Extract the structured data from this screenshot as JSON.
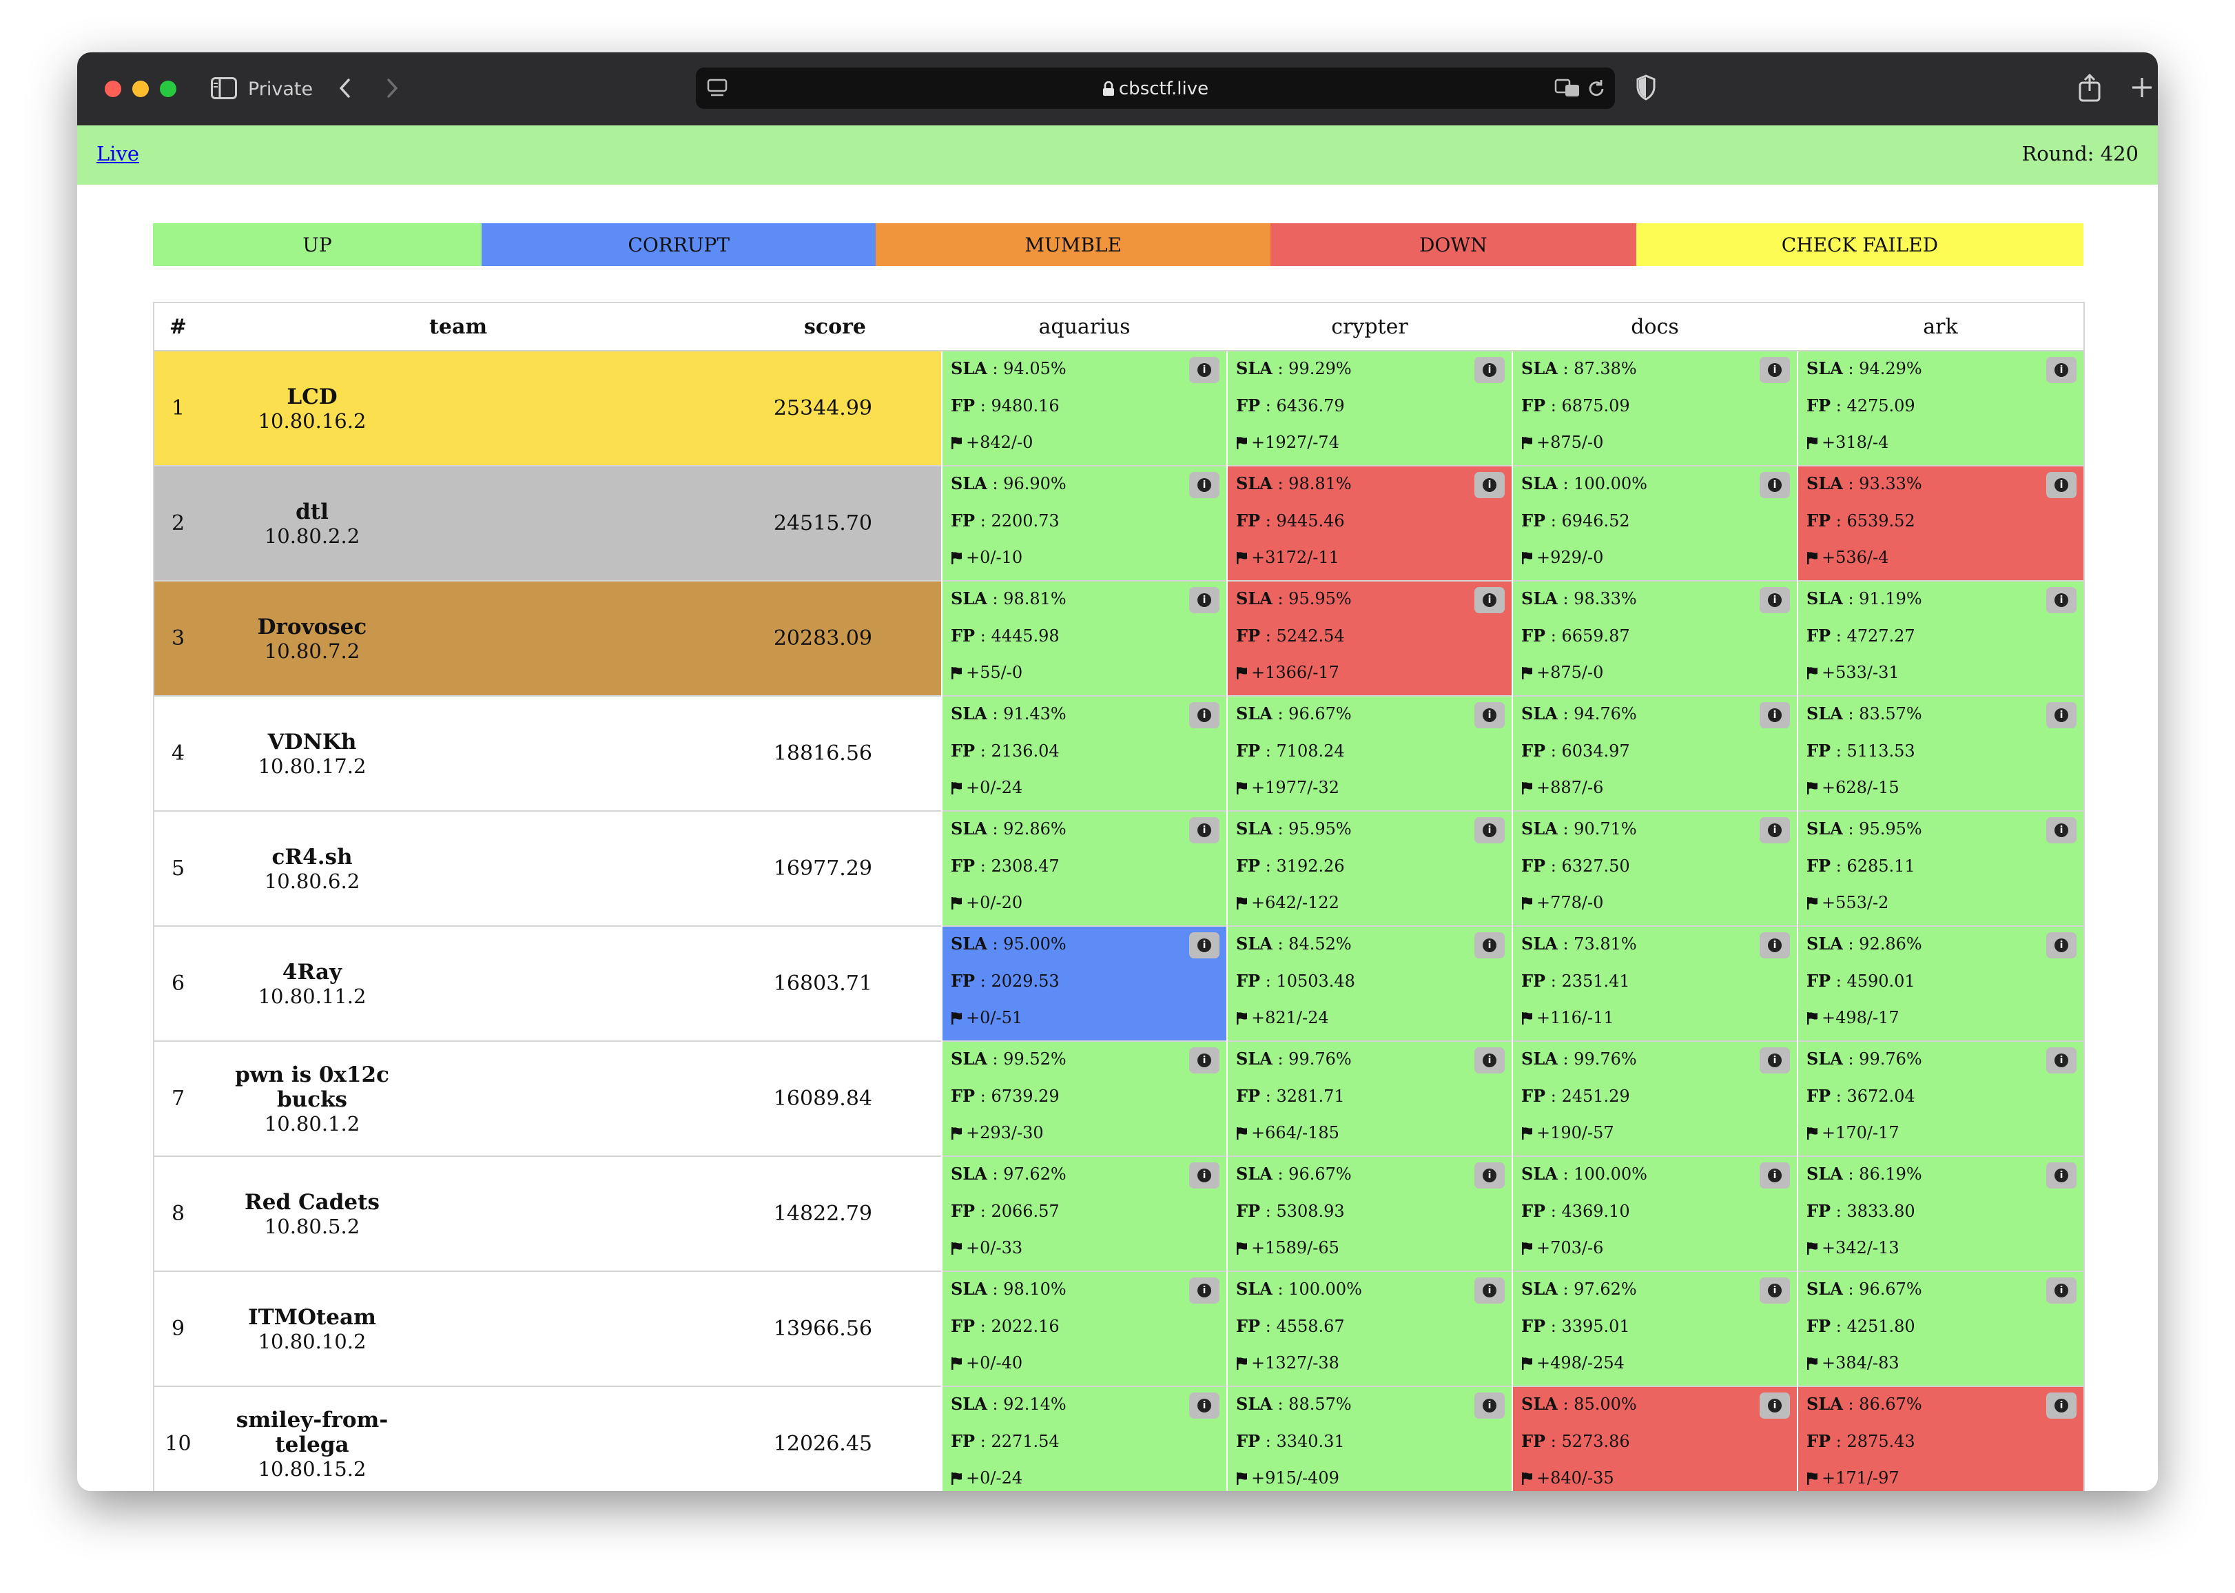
{
  "browser": {
    "private_label": "Private",
    "url": "cbsctf.live"
  },
  "topbar": {
    "live_link": "Live",
    "round": "Round: 420"
  },
  "legend": [
    {
      "label": "UP",
      "color": "#a0f58a",
      "width_ratio": 460
    },
    {
      "label": "CORRUPT",
      "color": "#5d8cf6",
      "width_ratio": 552
    },
    {
      "label": "MUMBLE",
      "color": "#f0953b",
      "width_ratio": 552
    },
    {
      "label": "DOWN",
      "color": "#ec645f",
      "width_ratio": 512
    },
    {
      "label": "CHECK FAILED",
      "color": "#fdfc54",
      "width_ratio": 626
    }
  ],
  "status_colors": {
    "up": "#a0f58a",
    "corrupt": "#5d8cf6",
    "mumble": "#f0953b",
    "down": "#ec645f",
    "check_failed": "#fdfc54"
  },
  "rank_colors": {
    "1": "#fbdf4e",
    "2": "#c0c0c0",
    "3": "#c9974b"
  },
  "table": {
    "headers": {
      "rank": "#",
      "team": "team",
      "score": "score"
    },
    "services": [
      "aquarius",
      "crypter",
      "docs",
      "ark"
    ],
    "labels": {
      "sla": "SLA",
      "fp": "FP"
    },
    "rows": [
      {
        "rank": "1",
        "name": "LCD",
        "ip": "10.80.16.2",
        "score": "25344.99",
        "services": [
          {
            "status": "up",
            "sla": "94.05%",
            "fp": "9480.16",
            "flags": "+842/-0"
          },
          {
            "status": "up",
            "sla": "99.29%",
            "fp": "6436.79",
            "flags": "+1927/-74"
          },
          {
            "status": "up",
            "sla": "87.38%",
            "fp": "6875.09",
            "flags": "+875/-0"
          },
          {
            "status": "up",
            "sla": "94.29%",
            "fp": "4275.09",
            "flags": "+318/-4"
          }
        ]
      },
      {
        "rank": "2",
        "name": "dtl",
        "ip": "10.80.2.2",
        "score": "24515.70",
        "services": [
          {
            "status": "up",
            "sla": "96.90%",
            "fp": "2200.73",
            "flags": "+0/-10"
          },
          {
            "status": "down",
            "sla": "98.81%",
            "fp": "9445.46",
            "flags": "+3172/-11"
          },
          {
            "status": "up",
            "sla": "100.00%",
            "fp": "6946.52",
            "flags": "+929/-0"
          },
          {
            "status": "down",
            "sla": "93.33%",
            "fp": "6539.52",
            "flags": "+536/-4"
          }
        ]
      },
      {
        "rank": "3",
        "name": "Drovosec",
        "ip": "10.80.7.2",
        "score": "20283.09",
        "services": [
          {
            "status": "up",
            "sla": "98.81%",
            "fp": "4445.98",
            "flags": "+55/-0"
          },
          {
            "status": "down",
            "sla": "95.95%",
            "fp": "5242.54",
            "flags": "+1366/-17"
          },
          {
            "status": "up",
            "sla": "98.33%",
            "fp": "6659.87",
            "flags": "+875/-0"
          },
          {
            "status": "up",
            "sla": "91.19%",
            "fp": "4727.27",
            "flags": "+533/-31"
          }
        ]
      },
      {
        "rank": "4",
        "name": "VDNKh",
        "ip": "10.80.17.2",
        "score": "18816.56",
        "services": [
          {
            "status": "up",
            "sla": "91.43%",
            "fp": "2136.04",
            "flags": "+0/-24"
          },
          {
            "status": "up",
            "sla": "96.67%",
            "fp": "7108.24",
            "flags": "+1977/-32"
          },
          {
            "status": "up",
            "sla": "94.76%",
            "fp": "6034.97",
            "flags": "+887/-6"
          },
          {
            "status": "up",
            "sla": "83.57%",
            "fp": "5113.53",
            "flags": "+628/-15"
          }
        ]
      },
      {
        "rank": "5",
        "name": "cR4.sh",
        "ip": "10.80.6.2",
        "score": "16977.29",
        "services": [
          {
            "status": "up",
            "sla": "92.86%",
            "fp": "2308.47",
            "flags": "+0/-20"
          },
          {
            "status": "up",
            "sla": "95.95%",
            "fp": "3192.26",
            "flags": "+642/-122"
          },
          {
            "status": "up",
            "sla": "90.71%",
            "fp": "6327.50",
            "flags": "+778/-0"
          },
          {
            "status": "up",
            "sla": "95.95%",
            "fp": "6285.11",
            "flags": "+553/-2"
          }
        ]
      },
      {
        "rank": "6",
        "name": "4Ray",
        "ip": "10.80.11.2",
        "score": "16803.71",
        "services": [
          {
            "status": "corrupt",
            "sla": "95.00%",
            "fp": "2029.53",
            "flags": "+0/-51"
          },
          {
            "status": "up",
            "sla": "84.52%",
            "fp": "10503.48",
            "flags": "+821/-24"
          },
          {
            "status": "up",
            "sla": "73.81%",
            "fp": "2351.41",
            "flags": "+116/-11"
          },
          {
            "status": "up",
            "sla": "92.86%",
            "fp": "4590.01",
            "flags": "+498/-17"
          }
        ]
      },
      {
        "rank": "7",
        "name": "pwn is 0x12c bucks",
        "ip": "10.80.1.2",
        "score": "16089.84",
        "services": [
          {
            "status": "up",
            "sla": "99.52%",
            "fp": "6739.29",
            "flags": "+293/-30"
          },
          {
            "status": "up",
            "sla": "99.76%",
            "fp": "3281.71",
            "flags": "+664/-185"
          },
          {
            "status": "up",
            "sla": "99.76%",
            "fp": "2451.29",
            "flags": "+190/-57"
          },
          {
            "status": "up",
            "sla": "99.76%",
            "fp": "3672.04",
            "flags": "+170/-17"
          }
        ]
      },
      {
        "rank": "8",
        "name": "Red Cadets",
        "ip": "10.80.5.2",
        "score": "14822.79",
        "services": [
          {
            "status": "up",
            "sla": "97.62%",
            "fp": "2066.57",
            "flags": "+0/-33"
          },
          {
            "status": "up",
            "sla": "96.67%",
            "fp": "5308.93",
            "flags": "+1589/-65"
          },
          {
            "status": "up",
            "sla": "100.00%",
            "fp": "4369.10",
            "flags": "+703/-6"
          },
          {
            "status": "up",
            "sla": "86.19%",
            "fp": "3833.80",
            "flags": "+342/-13"
          }
        ]
      },
      {
        "rank": "9",
        "name": "ITMOteam",
        "ip": "10.80.10.2",
        "score": "13966.56",
        "services": [
          {
            "status": "up",
            "sla": "98.10%",
            "fp": "2022.16",
            "flags": "+0/-40"
          },
          {
            "status": "up",
            "sla": "100.00%",
            "fp": "4558.67",
            "flags": "+1327/-38"
          },
          {
            "status": "up",
            "sla": "97.62%",
            "fp": "3395.01",
            "flags": "+498/-254"
          },
          {
            "status": "up",
            "sla": "96.67%",
            "fp": "4251.80",
            "flags": "+384/-83"
          }
        ]
      },
      {
        "rank": "10",
        "name": "smiley-from-telega",
        "ip": "10.80.15.2",
        "score": "12026.45",
        "services": [
          {
            "status": "up",
            "sla": "92.14%",
            "fp": "2271.54",
            "flags": "+0/-24"
          },
          {
            "status": "up",
            "sla": "88.57%",
            "fp": "3340.31",
            "flags": "+915/-409"
          },
          {
            "status": "down",
            "sla": "85.00%",
            "fp": "5273.86",
            "flags": "+840/-35"
          },
          {
            "status": "down",
            "sla": "86.67%",
            "fp": "2875.43",
            "flags": "+171/-97"
          }
        ]
      }
    ]
  }
}
